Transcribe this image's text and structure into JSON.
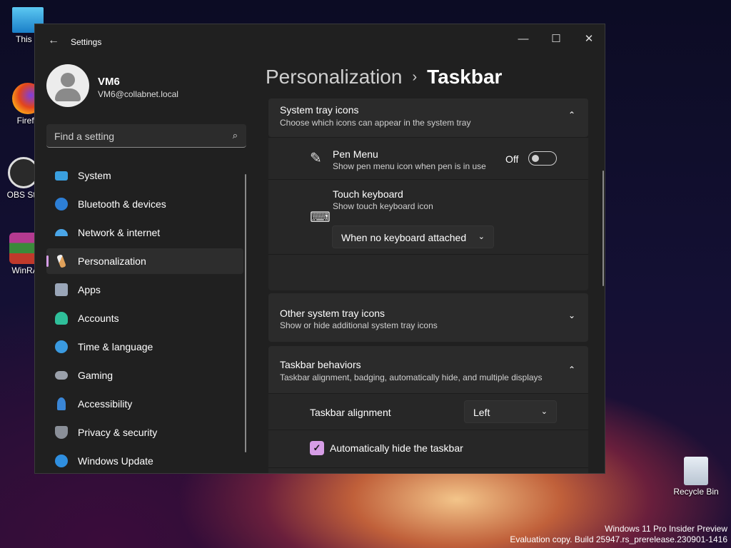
{
  "desktop": {
    "icons": [
      {
        "label": "This P",
        "color": "#38a8e0"
      },
      {
        "label": "Firefo",
        "color": "#ff7b1c"
      },
      {
        "label": "OBS Stu",
        "color": "#3a3a3a"
      },
      {
        "label": "WinRA",
        "color": "#a8322d"
      }
    ],
    "recycle_bin": "Recycle Bin",
    "watermark_line1": "Windows 11 Pro Insider Preview",
    "watermark_line2": "Evaluation copy. Build 25947.rs_prerelease.230901-1416"
  },
  "window": {
    "title": "Settings",
    "back_icon": "←",
    "minimize": "—",
    "maximize": "☐",
    "close": "✕"
  },
  "profile": {
    "name": "VM6",
    "email": "VM6@collabnet.local"
  },
  "search": {
    "placeholder": "Find a setting",
    "icon": "⌕"
  },
  "nav": {
    "items": [
      {
        "label": "System",
        "color": "#3aa0e0"
      },
      {
        "label": "Bluetooth & devices",
        "color": "#2d7fd6"
      },
      {
        "label": "Network & internet",
        "color": "#4aa6e8"
      },
      {
        "label": "Personalization",
        "color": "#e0a15a",
        "selected": true
      },
      {
        "label": "Apps",
        "color": "#9aa6b8"
      },
      {
        "label": "Accounts",
        "color": "#2fbf9a"
      },
      {
        "label": "Time & language",
        "color": "#3a9ae0"
      },
      {
        "label": "Gaming",
        "color": "#9aa0aa"
      },
      {
        "label": "Accessibility",
        "color": "#3a86d6"
      },
      {
        "label": "Privacy & security",
        "color": "#8a8f98"
      },
      {
        "label": "Windows Update",
        "color": "#2f8fe0"
      }
    ]
  },
  "breadcrumb": {
    "parent": "Personalization",
    "separator": "›",
    "current": "Taskbar"
  },
  "system_tray": {
    "title": "System tray icons",
    "subtitle": "Choose which icons can appear in the system tray",
    "chevron": "⌃",
    "pen_menu": {
      "title": "Pen Menu",
      "subtitle": "Show pen menu icon when pen is in use",
      "state": "Off",
      "icon": "✎"
    },
    "touch_keyboard": {
      "title": "Touch keyboard",
      "subtitle": "Show touch keyboard icon",
      "dropdown_value": "When no keyboard attached",
      "icon": "⌨"
    }
  },
  "other_tray": {
    "title": "Other system tray icons",
    "subtitle": "Show or hide additional system tray icons",
    "chevron": "⌄"
  },
  "behaviors": {
    "title": "Taskbar behaviors",
    "subtitle": "Taskbar alignment, badging, automatically hide, and multiple displays",
    "chevron": "⌃",
    "alignment_label": "Taskbar alignment",
    "alignment_value": "Left",
    "autohide_label": "Automatically hide the taskbar",
    "autohide_checked": true,
    "check_mark": "✓"
  },
  "dropdown_chevron": "⌄"
}
